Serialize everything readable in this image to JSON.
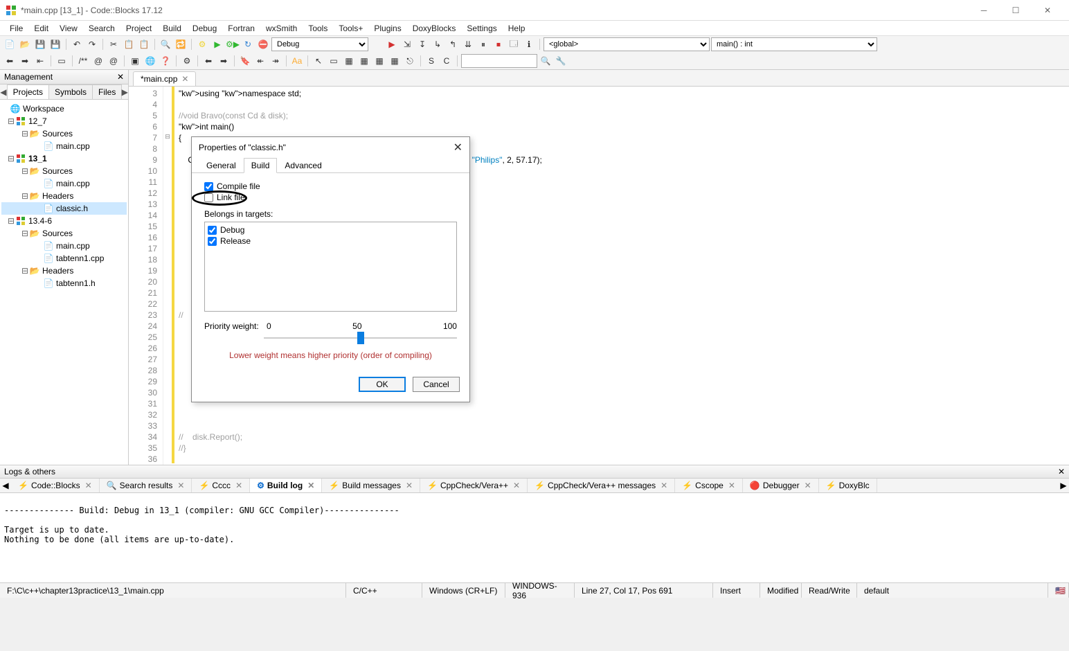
{
  "window": {
    "title": "*main.cpp [13_1] - Code::Blocks 17.12"
  },
  "menu": [
    "File",
    "Edit",
    "View",
    "Search",
    "Project",
    "Build",
    "Debug",
    "Fortran",
    "wxSmith",
    "Tools",
    "Tools+",
    "Plugins",
    "DoxyBlocks",
    "Settings",
    "Help"
  ],
  "toolbars": {
    "build_target": "Debug",
    "scope": "<global>",
    "func": "main() : int"
  },
  "management": {
    "title": "Management",
    "tabs": [
      "Projects",
      "Symbols",
      "Files"
    ],
    "active_tab": "Projects",
    "workspace": "Workspace",
    "projects": [
      {
        "name": "12_7",
        "folders": [
          {
            "name": "Sources",
            "files": [
              "main.cpp"
            ]
          }
        ]
      },
      {
        "name": "13_1",
        "bold": true,
        "folders": [
          {
            "name": "Sources",
            "files": [
              "main.cpp"
            ]
          },
          {
            "name": "Headers",
            "files": [
              "classic.h"
            ],
            "selected_file": "classic.h"
          }
        ]
      },
      {
        "name": "13.4-6",
        "folders": [
          {
            "name": "Sources",
            "files": [
              "main.cpp",
              "tabtenn1.cpp"
            ]
          },
          {
            "name": "Headers",
            "files": [
              "tabtenn1.h"
            ]
          }
        ]
      }
    ]
  },
  "editor": {
    "tab": "*main.cpp",
    "first_line": 3,
    "lines": [
      "using namespace std;",
      "",
      "//void Bravo(const Cd & disk);",
      "int main()",
      "{",
      "",
      "    Classic c2 = Classic(\"Piano Sonata in B flat, Fantasia in C\", \"Alfred Brendel\", \"Philips\", 2, 57.17);",
      "",
      "",
      "",
      "",
      "",
      "",
      "",
      "",
      "",
      "",
      "",
      "",
      "",
      "//                                                      argument:\\n\";",
      "",
      "",
      "",
      "",
      "",
      "",
      "",
      "",
      "",
      "",
      "//    disk.Report();",
      "//}",
      ""
    ]
  },
  "dialog": {
    "title": "Properties of \"classic.h\"",
    "tabs": [
      "General",
      "Build",
      "Advanced"
    ],
    "active_tab": "Build",
    "compile_file": {
      "label": "Compile file",
      "checked": true
    },
    "link_file": {
      "label": "Link file",
      "checked": false
    },
    "belongs_label": "Belongs in targets:",
    "targets": [
      {
        "name": "Debug",
        "checked": true
      },
      {
        "name": "Release",
        "checked": true
      }
    ],
    "priority_label": "Priority weight:",
    "priority_min": "0",
    "priority_mid": "50",
    "priority_max": "100",
    "hint": "Lower weight means higher priority (order of compiling)",
    "ok": "OK",
    "cancel": "Cancel"
  },
  "logs": {
    "title": "Logs & others",
    "tabs": [
      "Code::Blocks",
      "Search results",
      "Cccc",
      "Build log",
      "Build messages",
      "CppCheck/Vera++",
      "CppCheck/Vera++ messages",
      "Cscope",
      "Debugger",
      "DoxyBlc"
    ],
    "active_tab": "Build log",
    "body": "\n-------------- Build: Debug in 13_1 (compiler: GNU GCC Compiler)---------------\n\nTarget is up to date.\nNothing to be done (all items are up-to-date).\n"
  },
  "status": {
    "path": "F:\\C\\c++\\chapter13practice\\13_1\\main.cpp",
    "lang": "C/C++",
    "eol": "Windows (CR+LF)",
    "enc": "WINDOWS-936",
    "pos": "Line 27, Col 17, Pos 691",
    "ins": "Insert",
    "mod": "Modified",
    "rw": "Read/Write",
    "prof": "default"
  }
}
